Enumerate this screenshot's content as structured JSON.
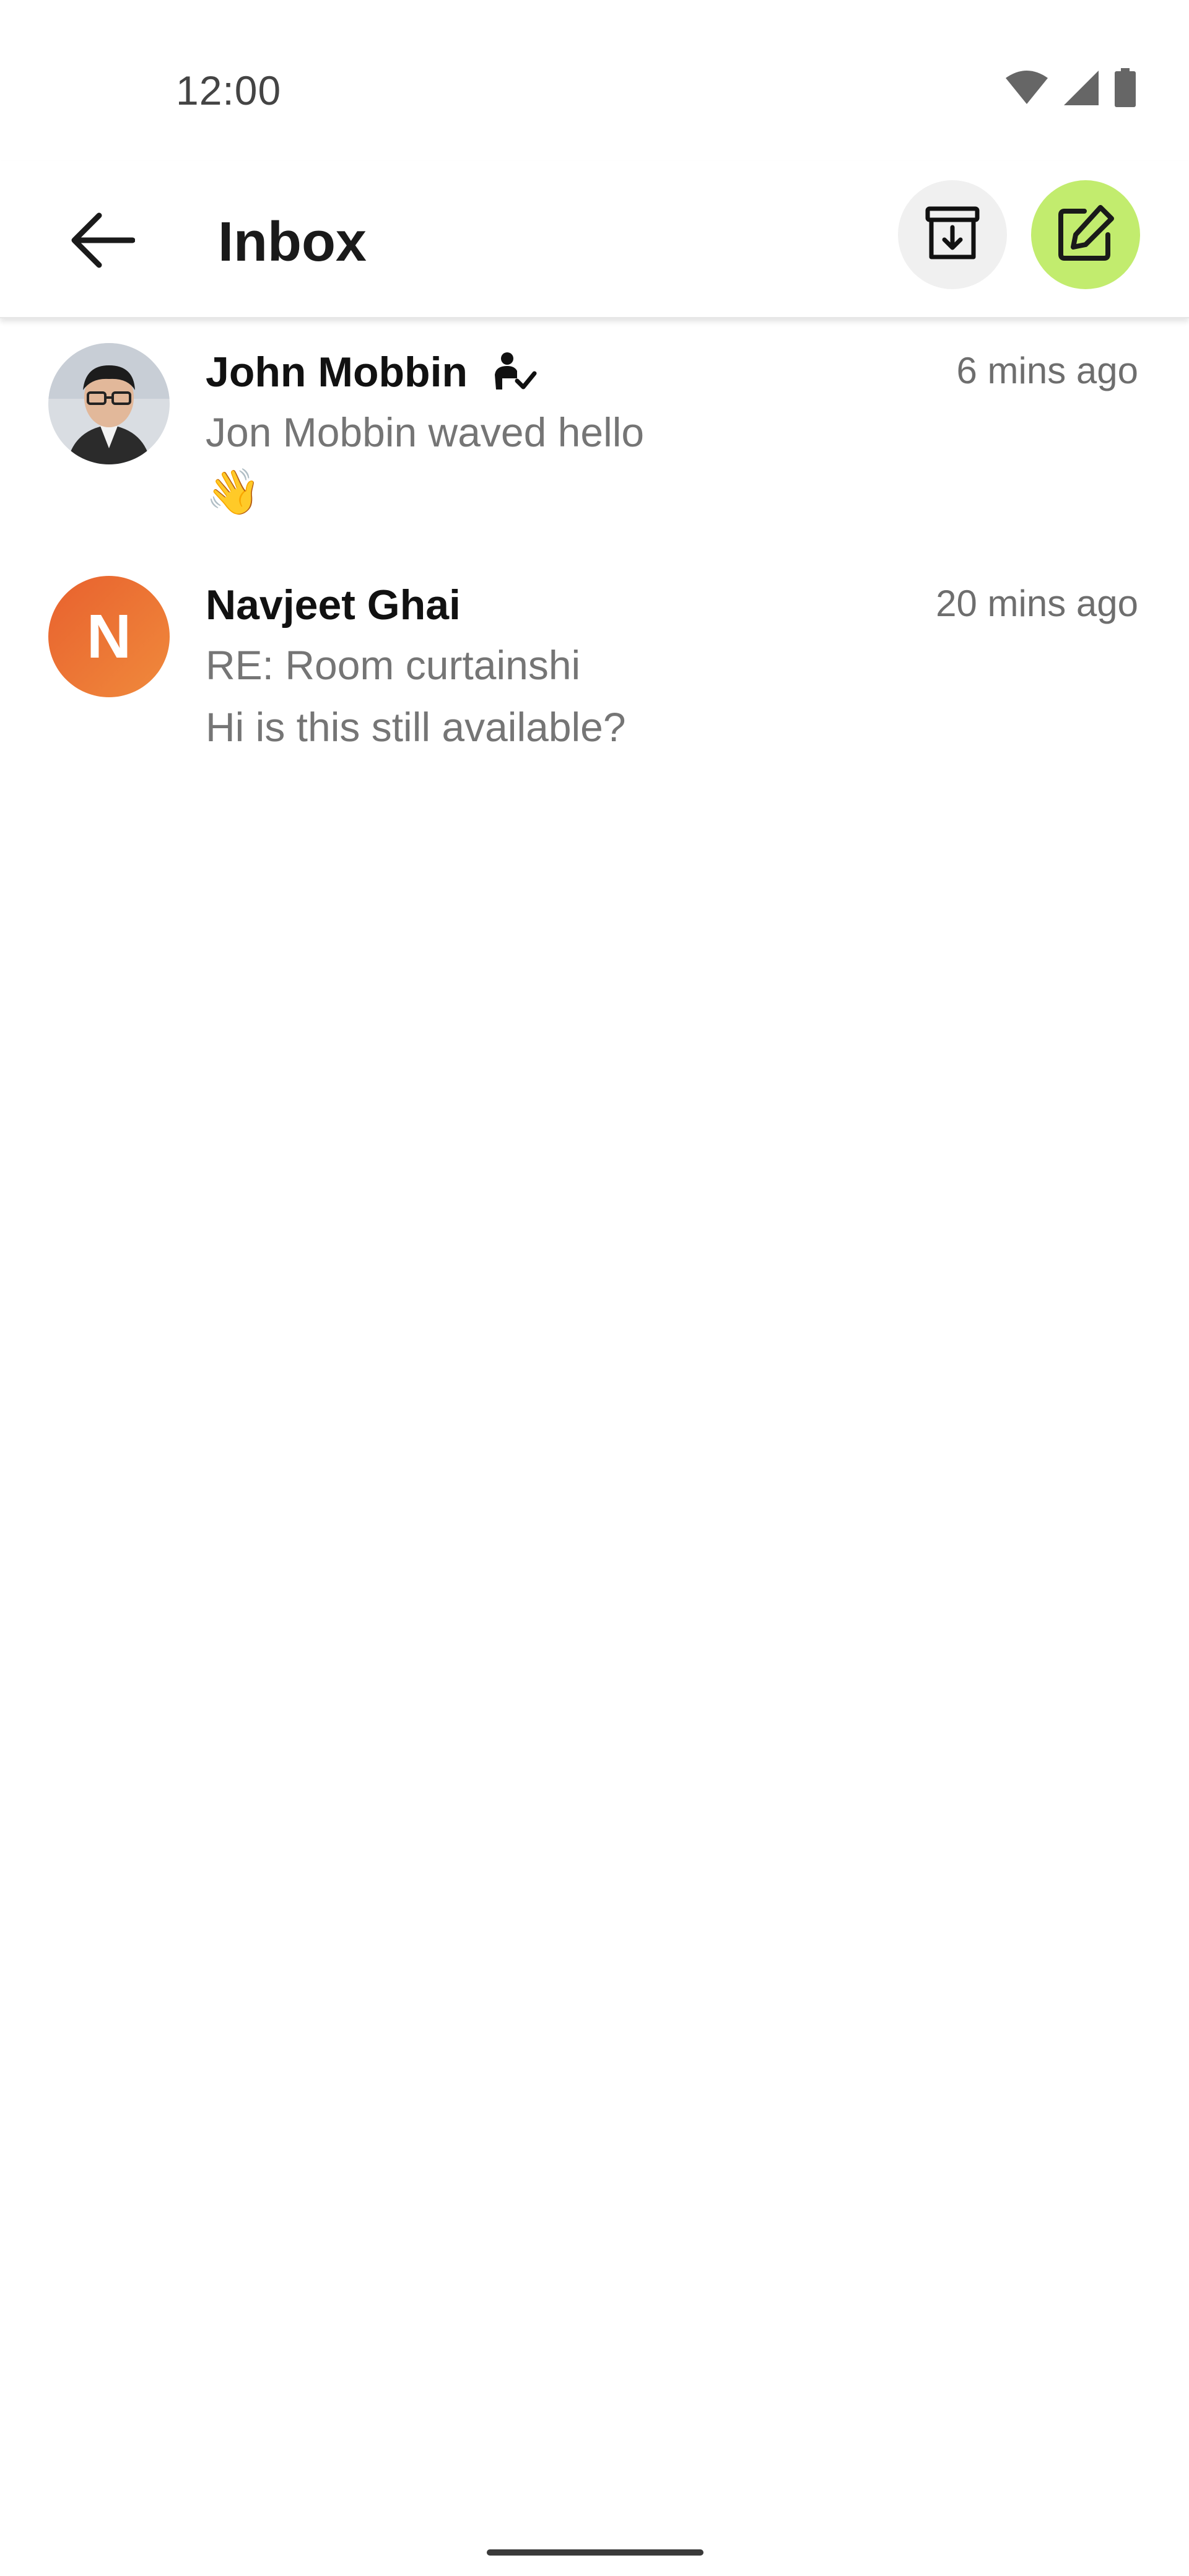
{
  "status_bar": {
    "time": "12:00",
    "icons": [
      "wifi-icon",
      "cellular-signal-icon",
      "battery-icon"
    ]
  },
  "app_bar": {
    "title": "Inbox",
    "back_icon": "arrow-left-icon",
    "archive_icon": "archive-download-icon",
    "compose_icon": "edit-pencil-icon",
    "colors": {
      "compose_bg": "#c2ec6e",
      "archive_bg": "#f0f0f0"
    }
  },
  "conversations": [
    {
      "name": "John Mobbin",
      "badge_icon": "verified-person-icon",
      "time": "6 mins ago",
      "preview": "Jon Mobbin waved hello",
      "emoji": "👋",
      "avatar": "photo"
    },
    {
      "name": "Navjeet Ghai",
      "time": "20 mins ago",
      "subject": "RE: Room curtainshi",
      "preview": "Hi is this still available?",
      "avatar_letter": "N",
      "avatar_color": "#e8612e"
    }
  ]
}
